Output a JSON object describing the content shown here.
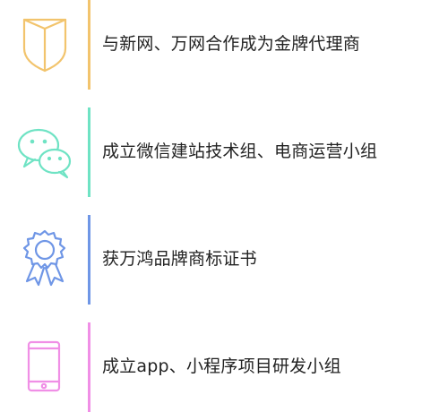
{
  "timeline": {
    "items": [
      {
        "text": "与新网、万网合作成为金牌代理商",
        "icon": "shield-icon",
        "color": "#f2c46d"
      },
      {
        "text": "成立微信建站技术组、电商运营小组",
        "icon": "wechat-icon",
        "color": "#6fe3c4"
      },
      {
        "text": "获万鸿品牌商标证书",
        "icon": "award-ribbon-icon",
        "color": "#6f96e6"
      },
      {
        "text": "成立app、小程序项目研发小组",
        "icon": "tablet-icon",
        "color": "#f08fe6"
      }
    ]
  }
}
